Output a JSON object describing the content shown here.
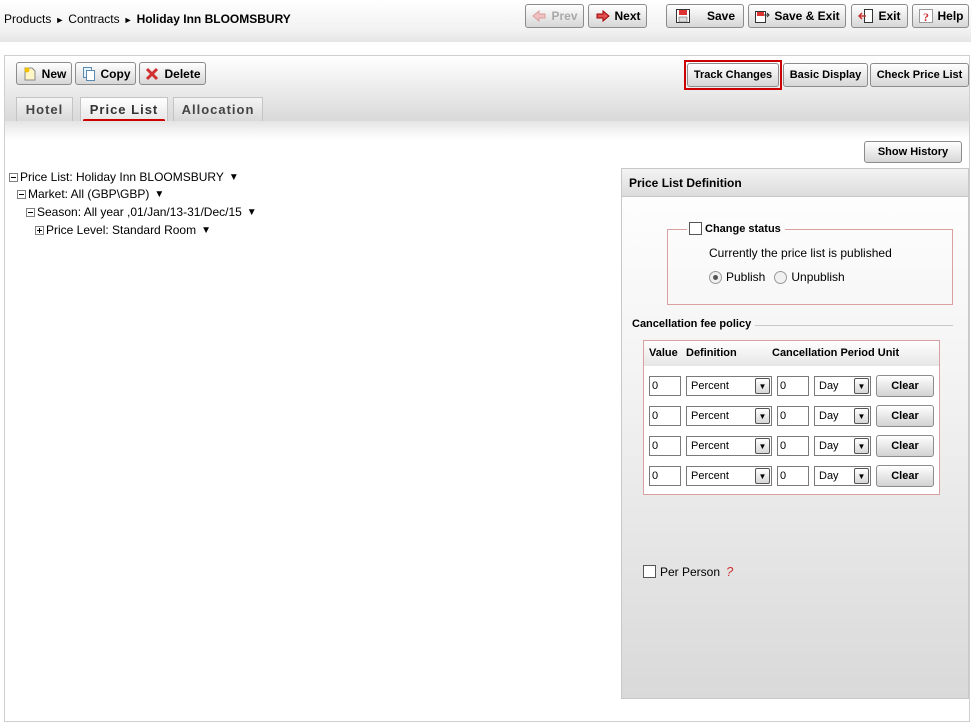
{
  "breadcrumb": {
    "items": [
      "Products",
      "Contracts"
    ],
    "current": "Holiday Inn BLOOMSBURY",
    "separator": "►"
  },
  "toolbar": {
    "prev": "Prev",
    "next": "Next",
    "save": "Save",
    "save_exit": "Save & Exit",
    "exit": "Exit",
    "help": "Help"
  },
  "actions": {
    "new": "New",
    "copy": "Copy",
    "delete": "Delete"
  },
  "right_actions": {
    "track_changes": "Track Changes",
    "basic_display": "Basic Display",
    "check_price_list": "Check Price List"
  },
  "tabs": [
    {
      "label": "Hotel",
      "active": false
    },
    {
      "label": "Price List",
      "active": true
    },
    {
      "label": "Allocation",
      "active": false
    }
  ],
  "show_history": "Show History",
  "tree": {
    "price_list": "Price List: Holiday Inn BLOOMSBURY",
    "market": "Market: All (GBP\\GBP)",
    "season": "Season: All year ,01/Jan/13-31/Dec/15",
    "price_level": "Price Level: Standard Room",
    "caret": "▼"
  },
  "definition": {
    "title": "Price List Definition",
    "change_status": "Change status",
    "status_text": "Currently the price list is published",
    "publish": "Publish",
    "unpublish": "Unpublish",
    "selected": "Publish",
    "fee_policy": "Cancellation fee policy",
    "columns": {
      "value": "Value",
      "definition": "Definition",
      "period_unit": "Cancellation Period Unit"
    },
    "rows": [
      {
        "value": "0",
        "definition": "Percent",
        "period": "0",
        "unit": "Day",
        "clear": "Clear"
      },
      {
        "value": "0",
        "definition": "Percent",
        "period": "0",
        "unit": "Day",
        "clear": "Clear"
      },
      {
        "value": "0",
        "definition": "Percent",
        "period": "0",
        "unit": "Day",
        "clear": "Clear"
      },
      {
        "value": "0",
        "definition": "Percent",
        "period": "0",
        "unit": "Day",
        "clear": "Clear"
      }
    ],
    "per_person": "Per Person",
    "help_icon": "?"
  },
  "colors": {
    "accent_red": "#cc0000",
    "border_pink": "#d8a0a0"
  },
  "icons": [
    "prev-arrow-icon",
    "next-arrow-icon",
    "save-disk-icon",
    "save-exit-icon",
    "exit-door-icon",
    "help-icon",
    "new-document-icon",
    "copy-icon",
    "delete-x-icon",
    "help-question-icon"
  ]
}
